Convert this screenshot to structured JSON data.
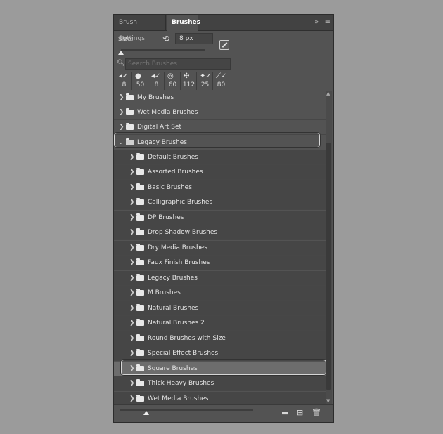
{
  "tabs": [
    {
      "label": "Brush Settings"
    },
    {
      "label": "Brushes"
    }
  ],
  "tabbar_icons": {
    "collapse": "»",
    "menu": "≡"
  },
  "size": {
    "label": "Size:",
    "value": "8 px",
    "reset_icon": "undo-icon"
  },
  "search": {
    "placeholder": "Search Brushes"
  },
  "presets": [
    {
      "glyph": "◂✓",
      "value": "8"
    },
    {
      "glyph": "●",
      "value": "50"
    },
    {
      "glyph": "◂✓",
      "value": "8"
    },
    {
      "glyph": "◎",
      "value": "60"
    },
    {
      "glyph": "✣",
      "value": "112"
    },
    {
      "glyph": "✦✓",
      "value": "25"
    },
    {
      "glyph": "⟋✓",
      "value": "80"
    }
  ],
  "list": {
    "top_level": [
      {
        "label": "My Brushes"
      },
      {
        "label": "Wet Media Brushes"
      },
      {
        "label": "Digital Art Set"
      },
      {
        "label": "Legacy Brushes",
        "expanded": true
      }
    ],
    "children": [
      {
        "label": "Default Brushes"
      },
      {
        "label": "Assorted Brushes"
      },
      {
        "label": "Basic Brushes"
      },
      {
        "label": "Calligraphic Brushes"
      },
      {
        "label": "DP Brushes"
      },
      {
        "label": "Drop Shadow Brushes"
      },
      {
        "label": "Dry Media Brushes"
      },
      {
        "label": "Faux Finish Brushes"
      },
      {
        "label": "Legacy Brushes"
      },
      {
        "label": "M Brushes"
      },
      {
        "label": "Natural Brushes"
      },
      {
        "label": "Natural Brushes 2"
      },
      {
        "label": "Round Brushes with Size"
      },
      {
        "label": "Special Effect Brushes"
      },
      {
        "label": "Square Brushes",
        "selected": true
      },
      {
        "label": "Thick Heavy Brushes"
      },
      {
        "label": "Wet Media Brushes"
      }
    ]
  },
  "bottom_icons": [
    "folder-icon",
    "new-brush-icon",
    "trash-icon"
  ]
}
